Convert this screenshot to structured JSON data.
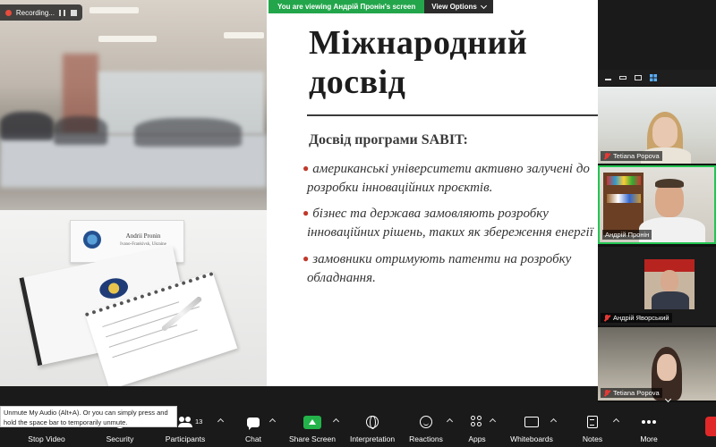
{
  "recording": {
    "label": "Recording..."
  },
  "banner": {
    "viewing": "You are viewing Андрій Пронін's screen",
    "view_options": "View Options"
  },
  "photo": {
    "nameplate_name": "Andrii Pronin",
    "nameplate_sub": "Ivano-Frankivsk, Ukraine"
  },
  "slide": {
    "title_line1": "Міжнародний",
    "title_line2": "досвід",
    "subtitle": "Досвід програми SABIT:",
    "bullets": [
      {
        "line1": "американські університети активно залучені до",
        "line2": "розробки інноваційних проєктів."
      },
      {
        "line1": "бізнес та держава замовляють розробку",
        "line2": "інноваційних рішень, таких як збереження енергії"
      },
      {
        "line1": "замовники отримують патенти на розробку",
        "line2": "обладнання."
      }
    ]
  },
  "participants": [
    {
      "name": "Tetiana Popova",
      "muted": true
    },
    {
      "name": "Андрій Пронін",
      "muted": false,
      "active_speaker": true
    },
    {
      "name": "Андрій Яворський",
      "muted": true
    },
    {
      "name": "Tetiana Popova",
      "muted": true
    }
  ],
  "tooltip": {
    "text": "Unmute My Audio (Alt+A). Or you can simply press and hold the space bar to temporarily unmute."
  },
  "toolbar": {
    "stop_video": "Stop Video",
    "security": "Security",
    "participants": "Participants",
    "participant_count": "13",
    "chat": "Chat",
    "share_screen": "Share Screen",
    "interpretation": "Interpretation",
    "reactions": "Reactions",
    "apps": "Apps",
    "whiteboards": "Whiteboards",
    "notes": "Notes",
    "more": "More"
  },
  "colors": {
    "accent_green": "#23B34A",
    "end_red": "#E02828",
    "bullet_red": "#C0392B"
  }
}
